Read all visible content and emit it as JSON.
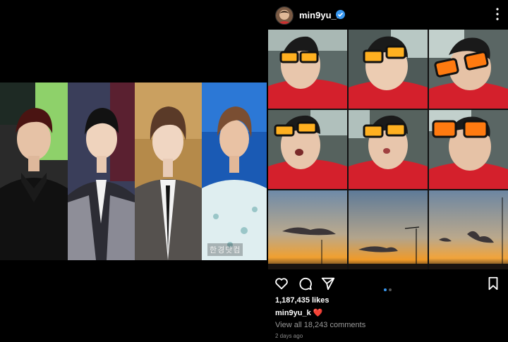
{
  "post": {
    "username": "min9yu_k",
    "likes": "1,187,435 likes",
    "caption_user": "min9yu_k",
    "caption_emoji": "❤️",
    "comments_link": "View all 18,243 comments",
    "timestamp": "2 days ago",
    "carousel_count": 2,
    "carousel_active": 1
  },
  "left_panel": {
    "watermark": "한경닷컴"
  },
  "icons": {
    "verified": "verified-badge-icon",
    "more": "more-options-icon",
    "like": "heart-icon",
    "comment": "comment-icon",
    "share": "share-icon",
    "save": "bookmark-icon"
  },
  "colors": {
    "background": "#000000",
    "verified_blue": "#3897f0",
    "heart_red": "#ed2d3c",
    "muted_text": "#9a9a9a"
  }
}
